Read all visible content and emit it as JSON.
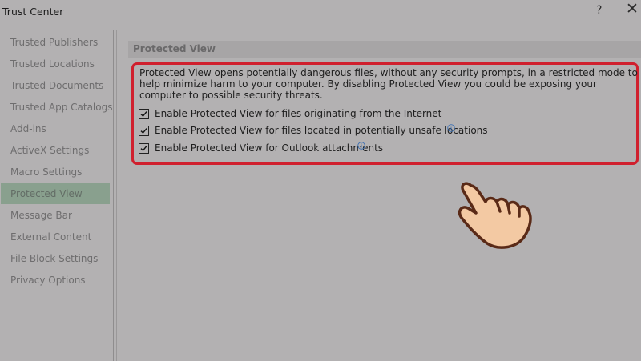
{
  "window": {
    "title": "Trust Center",
    "help_symbol": "?",
    "close_symbol": "✕"
  },
  "sidebar": {
    "items": [
      {
        "label": "Trusted Publishers"
      },
      {
        "label": "Trusted Locations"
      },
      {
        "label": "Trusted Documents"
      },
      {
        "label": "Trusted App Catalogs"
      },
      {
        "label": "Add-ins"
      },
      {
        "label": "ActiveX Settings"
      },
      {
        "label": "Macro Settings"
      },
      {
        "label": "Protected View",
        "selected": true
      },
      {
        "label": "Message Bar"
      },
      {
        "label": "External Content"
      },
      {
        "label": "File Block Settings"
      },
      {
        "label": "Privacy Options"
      }
    ]
  },
  "protected_view": {
    "section_title": "Protected View",
    "description": "Protected View opens potentially dangerous files, without any security prompts, in a restricted mode to help minimize harm to your computer. By disabling Protected View you could be exposing your computer to possible security threats.",
    "options": [
      {
        "label": "Enable Protected View for files originating from the Internet",
        "checked": true
      },
      {
        "label": "Enable Protected View for files located in potentially unsafe locations",
        "checked": true,
        "info_icon": "info-icon"
      },
      {
        "label": "Enable Protected View for Outlook attachments",
        "checked": true,
        "info_icon": "info-icon"
      }
    ]
  },
  "colors": {
    "background": "#b3b1b2",
    "selected_nav": "#89a08e",
    "highlight_border": "#d0202e"
  },
  "annotation": {
    "icon": "pointing-hand-icon"
  }
}
